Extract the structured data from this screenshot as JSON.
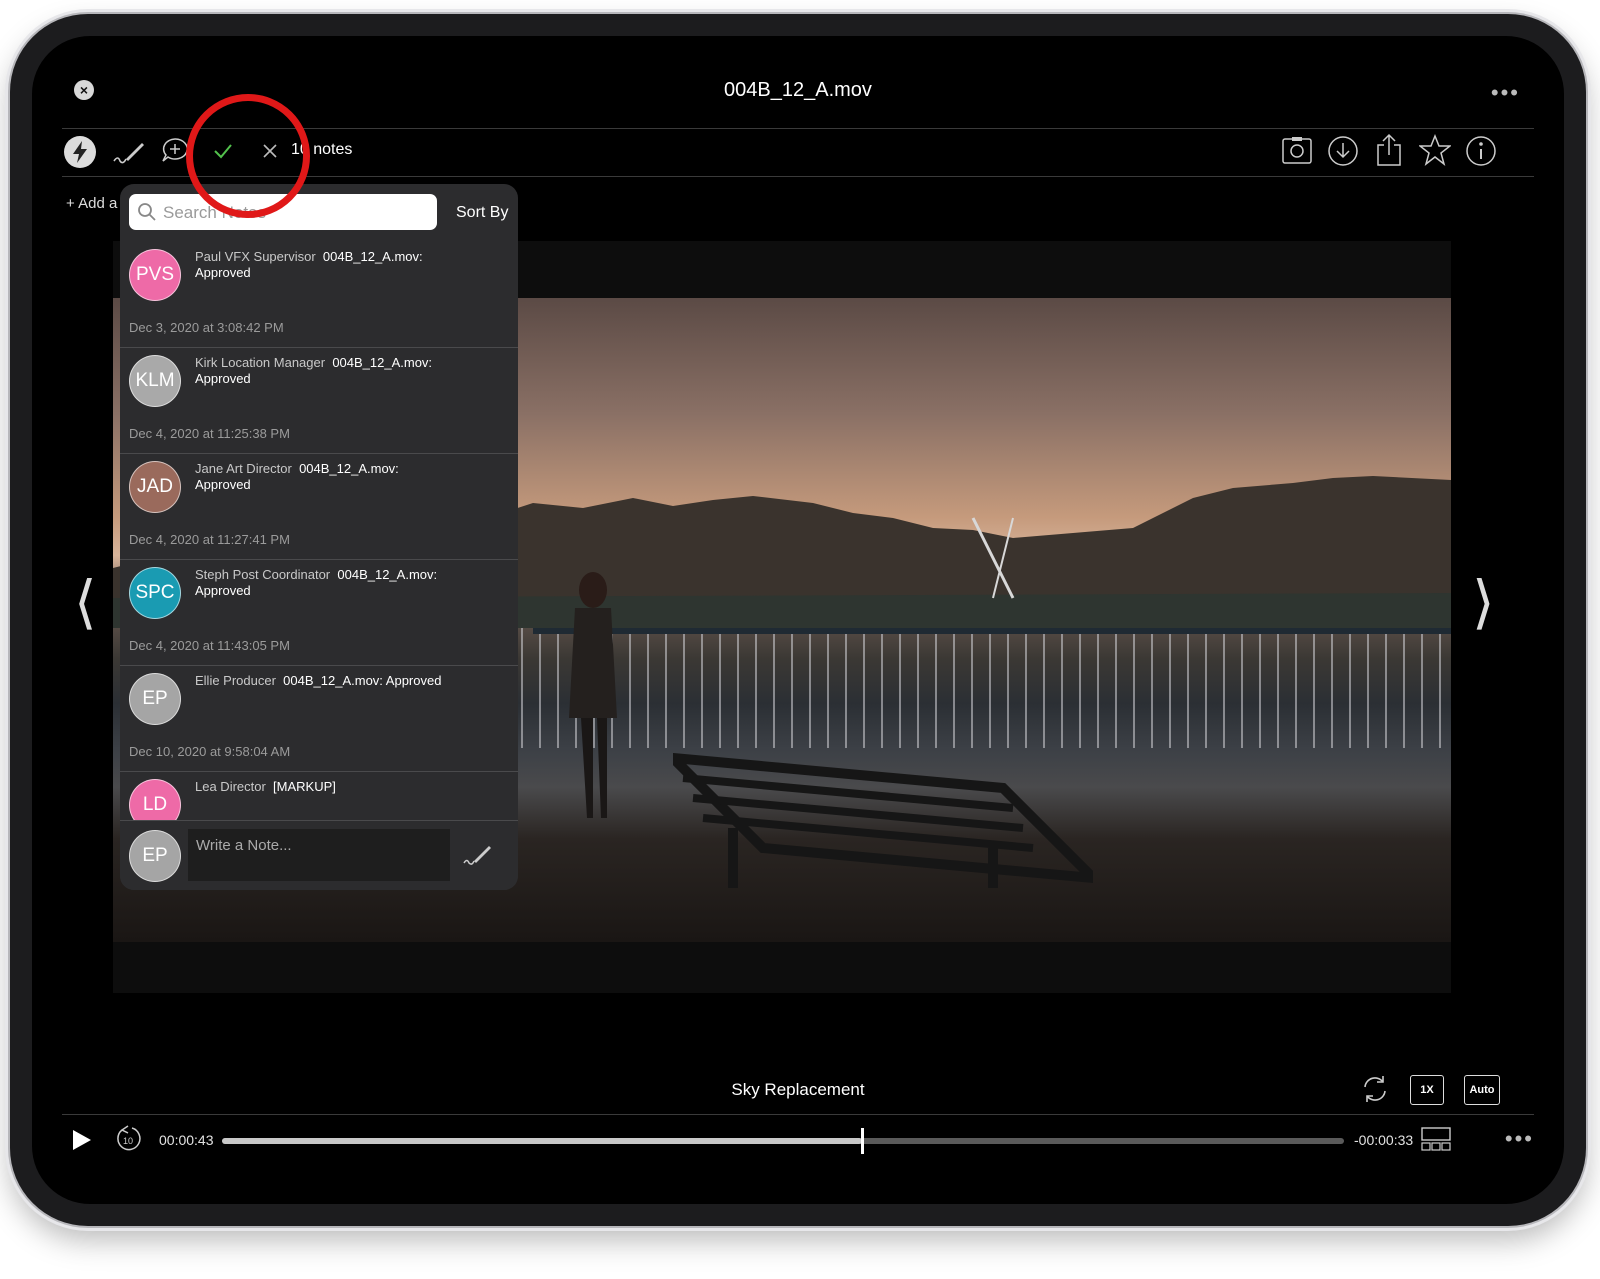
{
  "header": {
    "file_title": "004B_12_A.mov",
    "close_icon": "close-icon",
    "more_icon": "more-icon"
  },
  "toolbar": {
    "notes_count": "10 notes",
    "add_label": "+ Add a",
    "icons": [
      "lightning-icon",
      "signature-pen-icon",
      "add-comment-icon",
      "approve-check-icon",
      "reject-x-icon",
      "snapshot-icon",
      "download-icon",
      "share-icon",
      "star-icon",
      "info-icon"
    ]
  },
  "notes_panel": {
    "search_placeholder": "Search Notes",
    "sort_label": "Sort By",
    "notes": [
      {
        "initials": "PVS",
        "color": "#ee6aa7",
        "author": "Paul VFX Supervisor",
        "message": "004B_12_A.mov: Approved",
        "timestamp": "Dec 3, 2020 at 3:08:42 PM"
      },
      {
        "initials": "KLM",
        "color": "#a9a9a9",
        "author": "Kirk Location Manager",
        "message": "004B_12_A.mov: Approved",
        "timestamp": "Dec 4, 2020 at 11:25:38 PM"
      },
      {
        "initials": "JAD",
        "color": "#9a6a5c",
        "author": "Jane Art Director",
        "message": "004B_12_A.mov: Approved",
        "timestamp": "Dec 4, 2020 at 11:27:41 PM"
      },
      {
        "initials": "SPC",
        "color": "#1a9bb2",
        "author": "Steph Post Coordinator",
        "message": "004B_12_A.mov: Approved",
        "timestamp": "Dec 4, 2020 at 11:43:05 PM"
      },
      {
        "initials": "EP",
        "color": "#a5a5a5",
        "author": "Ellie Producer",
        "message": "004B_12_A.mov: Approved",
        "timestamp": "Dec 10, 2020 at 9:58:04 AM"
      },
      {
        "initials": "LD",
        "color": "#ee6aa7",
        "author": "Lea Director",
        "message": "[MARKUP]",
        "timestamp": ""
      }
    ],
    "compose": {
      "initials": "EP",
      "placeholder": "Write a Note...",
      "pen_icon": "signature-pen-icon"
    }
  },
  "player": {
    "clip_name": "Sky Replacement",
    "elapsed": "00:00:43",
    "remaining": "-00:00:33",
    "progress": 0.57,
    "speed_label": "1X",
    "quality_label": "Auto",
    "icons": [
      "play-icon",
      "rewind-10-icon",
      "loop-icon",
      "filmstrip-icon",
      "more-icon",
      "prev-arrow-icon",
      "next-arrow-icon"
    ]
  },
  "annotation": {
    "highlight_color": "#e01818"
  }
}
